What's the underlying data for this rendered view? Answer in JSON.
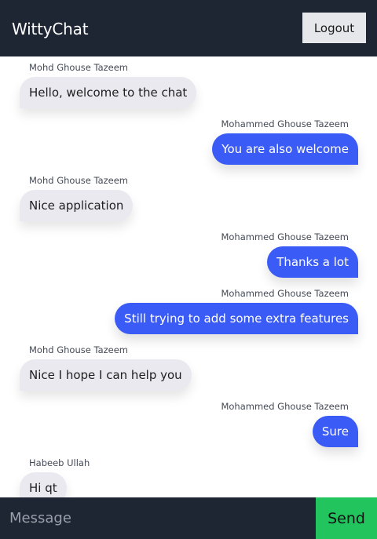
{
  "header": {
    "title": "WittyChat",
    "logout_label": "Logout"
  },
  "messages": [
    {
      "sender": "Mohd Ghouse Tazeem",
      "text": "Hello, welcome to the chat",
      "side": "left"
    },
    {
      "sender": "Mohammed Ghouse Tazeem",
      "text": "You are also welcome",
      "side": "right"
    },
    {
      "sender": "Mohd Ghouse Tazeem",
      "text": "Nice application",
      "side": "left"
    },
    {
      "sender": "Mohammed Ghouse Tazeem",
      "text": "Thanks a lot",
      "side": "right"
    },
    {
      "sender": "Mohammed Ghouse Tazeem",
      "text": "Still trying to add some extra features",
      "side": "right"
    },
    {
      "sender": "Mohd Ghouse Tazeem",
      "text": "Nice I hope I can help you",
      "side": "left"
    },
    {
      "sender": "Mohammed Ghouse Tazeem",
      "text": "Sure",
      "side": "right"
    },
    {
      "sender": "Habeeb Ullah",
      "text": "Hi qt",
      "side": "left"
    }
  ],
  "composer": {
    "placeholder": "Message",
    "value": "",
    "send_label": "Send"
  },
  "colors": {
    "header_bg": "#1e2533",
    "own_bubble": "#3b5bf6",
    "other_bubble": "#e9e9ef",
    "send_button": "#22c45e"
  }
}
